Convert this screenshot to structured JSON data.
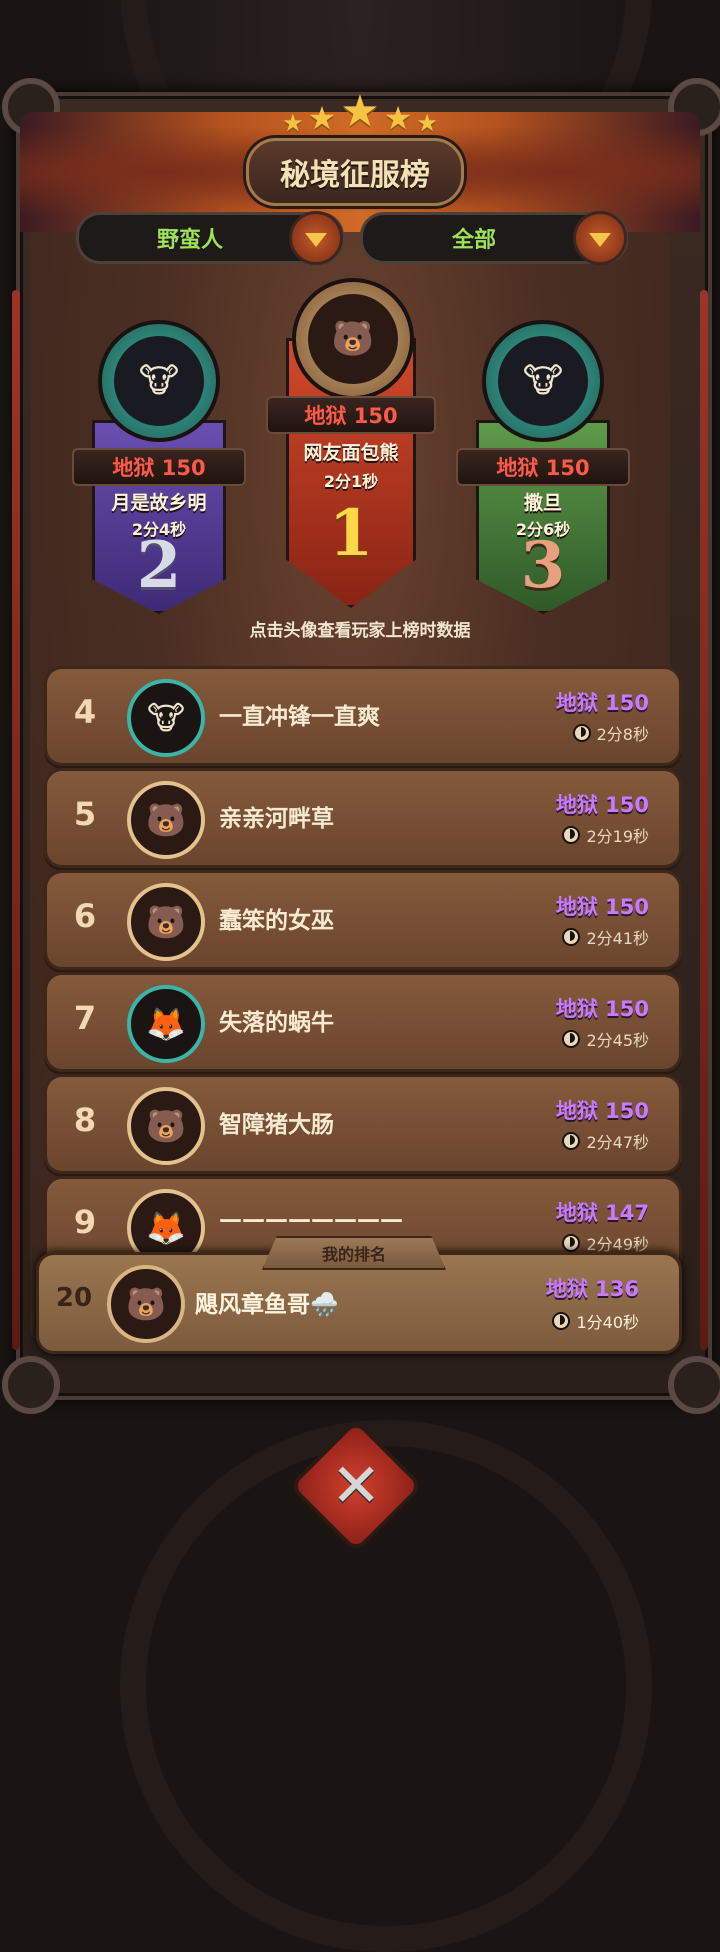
{
  "header": {
    "title": "秘境征服榜",
    "star_count": 5
  },
  "filters": {
    "class_filter": "野蛮人",
    "scope_filter": "全部"
  },
  "podium": [
    {
      "rank": "1",
      "score": "地狱 150",
      "name": "网友面包熊",
      "time": "2分1秒",
      "avatar_icon": "helmet-warrior"
    },
    {
      "rank": "2",
      "score": "地狱 150",
      "name": "月是故乡明",
      "time": "2分4秒",
      "avatar_icon": "cow-goggles"
    },
    {
      "rank": "3",
      "score": "地狱 150",
      "name": "撒旦",
      "time": "2分6秒",
      "avatar_icon": "cow-goggles"
    }
  ],
  "hint": "点击头像查看玩家上榜时数据",
  "rows": [
    {
      "rank": "4",
      "name": "一直冲锋一直爽",
      "score": "地狱 150",
      "time": "2分8秒"
    },
    {
      "rank": "5",
      "name": "亲亲河畔草",
      "score": "地狱 150",
      "time": "2分19秒"
    },
    {
      "rank": "6",
      "name": "蠢笨的女巫",
      "score": "地狱 150",
      "time": "2分41秒"
    },
    {
      "rank": "7",
      "name": "失落的蜗牛",
      "score": "地狱 150",
      "time": "2分45秒"
    },
    {
      "rank": "8",
      "name": "智障猪大肠",
      "score": "地狱 150",
      "time": "2分47秒"
    },
    {
      "rank": "9",
      "name": "————————",
      "score": "地狱 147",
      "time": "2分49秒"
    }
  ],
  "my_rank": {
    "tab_label": "我的排名",
    "rank": "20",
    "name": "飓风章鱼哥🌧️",
    "score": "地狱 136",
    "time": "1分40秒"
  },
  "colors": {
    "score_red": "#ff5a47",
    "score_purple": "#c67bff",
    "filter_green": "#9ee25a"
  }
}
